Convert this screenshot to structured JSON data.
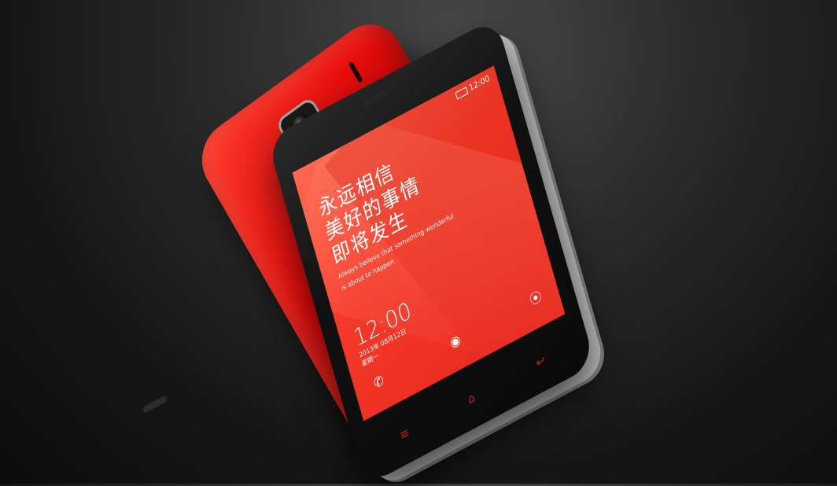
{
  "screen": {
    "status_time": "12:00",
    "headline": [
      "永远相信",
      "美好的事情",
      "即将发生"
    ],
    "subtitle": [
      "Always believe that something wonderful",
      "is about to happen"
    ],
    "clock_time": "12:00",
    "clock_date": "2013年 08月12日",
    "clock_weekday": "星期一"
  },
  "colors": {
    "phone_red": "#e80d0d",
    "screen_red": "#f53b2a",
    "background": "#1a1a1a"
  },
  "icons": {
    "lock_left": "phone-icon",
    "lock_center": "camera-icon",
    "lock_right": "message-icon",
    "keys": [
      "menu-icon",
      "home-icon",
      "back-icon"
    ]
  }
}
